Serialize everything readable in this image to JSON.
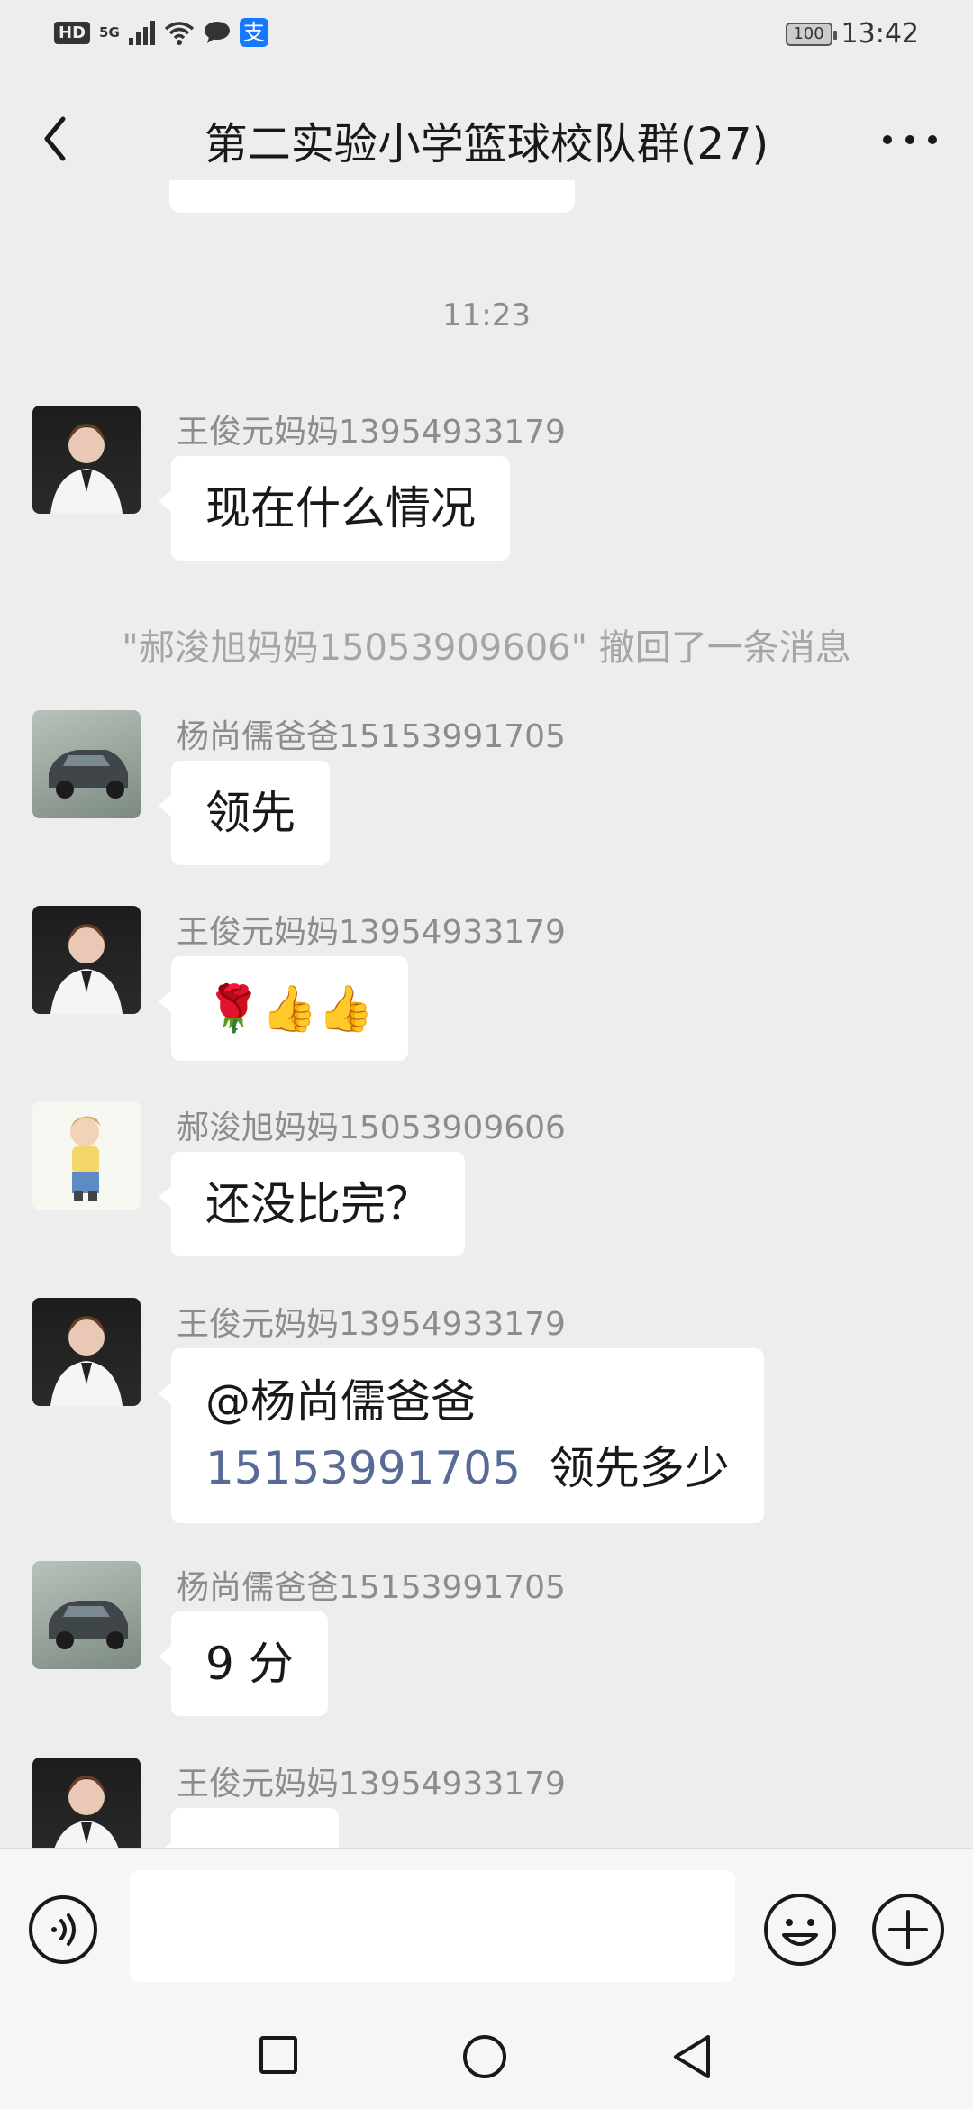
{
  "status_bar": {
    "hd": "HD",
    "signal": "5G",
    "battery": "100",
    "time": "13:42",
    "alipay_glyph": "支"
  },
  "header": {
    "title": "第二实验小学篮球校队群(27)"
  },
  "chat": {
    "time_stamp": "11:23",
    "recall_notice": "\"郝浚旭妈妈15053909606\" 撤回了一条消息",
    "messages": [
      {
        "sender": "王俊元妈妈13954933179",
        "text": "现在什么情况"
      },
      {
        "sender": "杨尚儒爸爸15153991705",
        "text": "领先"
      },
      {
        "sender": "王俊元妈妈13954933179",
        "text": "🌹👍👍"
      },
      {
        "sender": "郝浚旭妈妈15053909606",
        "text": "还没比完？"
      },
      {
        "sender": "王俊元妈妈13954933179",
        "mention": "@杨尚儒爸爸",
        "mention_number": "15153991705",
        "text": "领先多少"
      },
      {
        "sender": "杨尚儒爸爸15153991705",
        "text": "9 分"
      },
      {
        "sender": "王俊元妈妈13954933179",
        "text": ""
      }
    ]
  },
  "input_bar": {
    "voice_icon": "voice-icon",
    "emoji_icon": "emoji-icon",
    "plus_icon": "plus-icon"
  },
  "nav": {
    "recent": "square-icon",
    "home": "circle-icon",
    "back": "triangle-back-icon"
  }
}
